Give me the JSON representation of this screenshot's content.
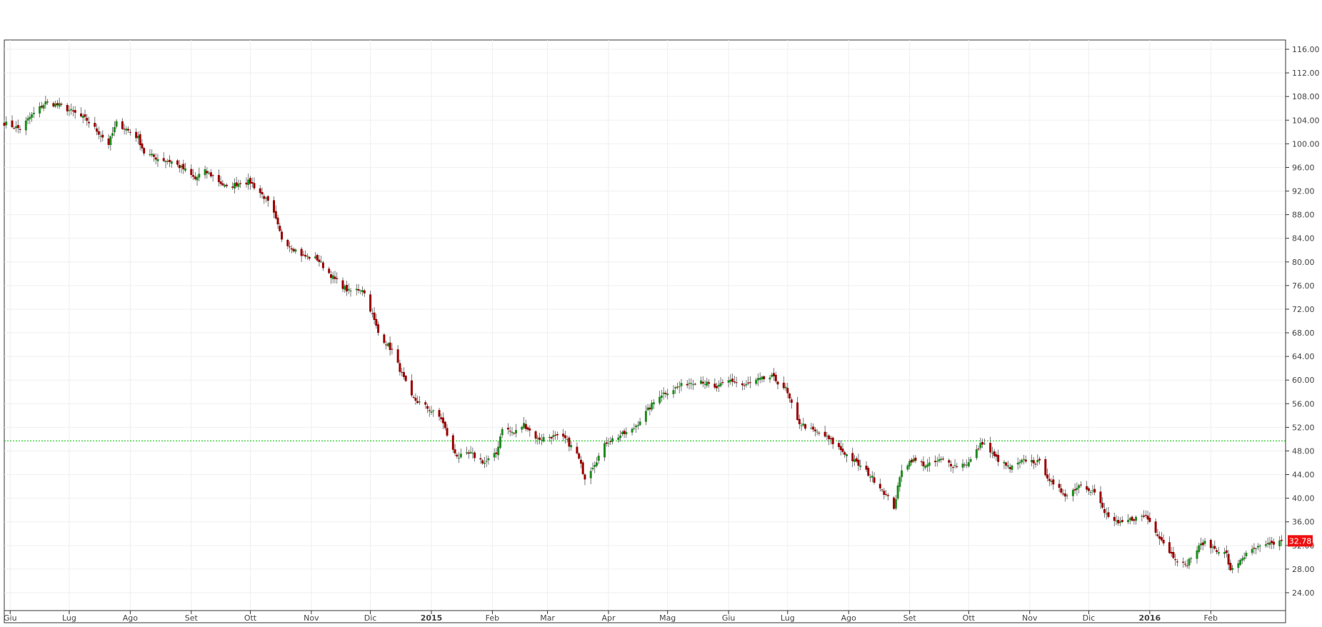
{
  "chart_data": {
    "type": "candlestick",
    "title": "",
    "xlabel": "",
    "ylabel": "",
    "ylim": [
      22,
      117
    ],
    "y_ticks": [
      "116.00",
      "112.00",
      "108.00",
      "104.00",
      "100.00",
      "96.00",
      "92.00",
      "88.00",
      "84.00",
      "80.00",
      "76.00",
      "72.00",
      "68.00",
      "64.00",
      "60.00",
      "56.00",
      "52.00",
      "48.00",
      "44.00",
      "40.00",
      "36.00",
      "32.00",
      "28.00",
      "24.00"
    ],
    "y_tick_values": [
      116,
      112,
      108,
      104,
      100,
      96,
      92,
      88,
      84,
      80,
      76,
      72,
      68,
      64,
      60,
      56,
      52,
      48,
      44,
      40,
      36,
      32,
      28,
      24
    ],
    "x_ticks": [
      {
        "label": "Giu",
        "date": "2014-06-01",
        "bold": false
      },
      {
        "label": "Lug",
        "date": "2014-07-01",
        "bold": false
      },
      {
        "label": "Ago",
        "date": "2014-08-01",
        "bold": false
      },
      {
        "label": "Set",
        "date": "2014-09-01",
        "bold": false
      },
      {
        "label": "Ott",
        "date": "2014-10-01",
        "bold": false
      },
      {
        "label": "Nov",
        "date": "2014-11-01",
        "bold": false
      },
      {
        "label": "Dic",
        "date": "2014-12-01",
        "bold": false
      },
      {
        "label": "2015",
        "date": "2015-01-01",
        "bold": true
      },
      {
        "label": "Feb",
        "date": "2015-02-01",
        "bold": false
      },
      {
        "label": "Mar",
        "date": "2015-03-01",
        "bold": false
      },
      {
        "label": "Apr",
        "date": "2015-04-01",
        "bold": false
      },
      {
        "label": "Mag",
        "date": "2015-05-01",
        "bold": false
      },
      {
        "label": "Giu",
        "date": "2015-06-01",
        "bold": false
      },
      {
        "label": "Lug",
        "date": "2015-07-01",
        "bold": false
      },
      {
        "label": "Ago",
        "date": "2015-08-01",
        "bold": false
      },
      {
        "label": "Set",
        "date": "2015-09-01",
        "bold": false
      },
      {
        "label": "Ott",
        "date": "2015-10-01",
        "bold": false
      },
      {
        "label": "Nov",
        "date": "2015-11-01",
        "bold": false
      },
      {
        "label": "Dic",
        "date": "2015-12-01",
        "bold": false
      },
      {
        "label": "2016",
        "date": "2016-01-01",
        "bold": true
      },
      {
        "label": "Feb",
        "date": "2016-02-01",
        "bold": false
      }
    ],
    "x_range": [
      "2014-05-29",
      "2016-03-10"
    ],
    "close_path": [
      [
        "2014-05-29",
        103.5
      ],
      [
        "2014-06-06",
        102.5
      ],
      [
        "2014-06-11",
        104.5
      ],
      [
        "2014-06-19",
        107.0
      ],
      [
        "2014-06-26",
        106.5
      ],
      [
        "2014-07-02",
        105.5
      ],
      [
        "2014-07-10",
        104.0
      ],
      [
        "2014-07-17",
        101.5
      ],
      [
        "2014-07-21",
        100.0
      ],
      [
        "2014-07-25",
        103.5
      ],
      [
        "2014-07-30",
        102.5
      ],
      [
        "2014-08-05",
        101.0
      ],
      [
        "2014-08-08",
        98.5
      ],
      [
        "2014-08-15",
        97.5
      ],
      [
        "2014-08-22",
        97.0
      ],
      [
        "2014-08-29",
        95.5
      ],
      [
        "2014-09-03",
        94.0
      ],
      [
        "2014-09-07",
        95.5
      ],
      [
        "2014-09-12",
        94.5
      ],
      [
        "2014-09-19",
        92.5
      ],
      [
        "2014-09-26",
        93.5
      ],
      [
        "2014-10-01",
        93.5
      ],
      [
        "2014-10-08",
        91.0
      ],
      [
        "2014-10-12",
        89.0
      ],
      [
        "2014-10-17",
        84.0
      ],
      [
        "2014-10-22",
        82.5
      ],
      [
        "2014-10-28",
        81.0
      ],
      [
        "2014-11-04",
        80.5
      ],
      [
        "2014-11-09",
        78.5
      ],
      [
        "2014-11-13",
        77.0
      ],
      [
        "2014-11-20",
        75.0
      ],
      [
        "2014-11-27",
        75.5
      ],
      [
        "2014-12-01",
        72.0
      ],
      [
        "2014-12-05",
        68.0
      ],
      [
        "2014-12-12",
        65.0
      ],
      [
        "2014-12-17",
        61.0
      ],
      [
        "2014-12-22",
        57.0
      ],
      [
        "2014-12-29",
        55.5
      ],
      [
        "2015-01-06",
        53.5
      ],
      [
        "2015-01-12",
        48.0
      ],
      [
        "2015-01-15",
        47.0
      ],
      [
        "2015-01-21",
        47.5
      ],
      [
        "2015-01-28",
        46.0
      ],
      [
        "2015-02-03",
        47.5
      ],
      [
        "2015-02-06",
        52.0
      ],
      [
        "2015-02-12",
        51.0
      ],
      [
        "2015-02-17",
        52.5
      ],
      [
        "2015-02-24",
        50.0
      ],
      [
        "2015-03-03",
        50.5
      ],
      [
        "2015-03-10",
        50.0
      ],
      [
        "2015-03-16",
        47.5
      ],
      [
        "2015-03-20",
        43.5
      ],
      [
        "2015-03-26",
        46.5
      ],
      [
        "2015-03-31",
        49.5
      ],
      [
        "2015-04-06",
        50.5
      ],
      [
        "2015-04-13",
        51.5
      ],
      [
        "2015-04-20",
        54.5
      ],
      [
        "2015-04-27",
        57.5
      ],
      [
        "2015-05-04",
        58.5
      ],
      [
        "2015-05-11",
        59.5
      ],
      [
        "2015-05-18",
        60.0
      ],
      [
        "2015-05-25",
        58.5
      ],
      [
        "2015-06-02",
        60.0
      ],
      [
        "2015-06-09",
        59.0
      ],
      [
        "2015-06-16",
        60.0
      ],
      [
        "2015-06-23",
        60.5
      ],
      [
        "2015-06-30",
        58.5
      ],
      [
        "2015-07-06",
        53.0
      ],
      [
        "2015-07-13",
        51.5
      ],
      [
        "2015-07-20",
        50.5
      ],
      [
        "2015-07-27",
        48.5
      ],
      [
        "2015-08-03",
        46.5
      ],
      [
        "2015-08-10",
        44.5
      ],
      [
        "2015-08-17",
        42.0
      ],
      [
        "2015-08-24",
        38.5
      ],
      [
        "2015-08-28",
        45.0
      ],
      [
        "2015-09-02",
        46.5
      ],
      [
        "2015-09-10",
        45.5
      ],
      [
        "2015-09-17",
        46.5
      ],
      [
        "2015-09-24",
        45.5
      ],
      [
        "2015-10-01",
        46.0
      ],
      [
        "2015-10-08",
        49.5
      ],
      [
        "2015-10-14",
        47.0
      ],
      [
        "2015-10-22",
        45.0
      ],
      [
        "2015-10-30",
        46.5
      ],
      [
        "2015-11-06",
        46.0
      ],
      [
        "2015-11-13",
        42.0
      ],
      [
        "2015-11-20",
        40.5
      ],
      [
        "2015-11-27",
        42.5
      ],
      [
        "2015-12-04",
        41.0
      ],
      [
        "2015-12-09",
        37.5
      ],
      [
        "2015-12-16",
        35.5
      ],
      [
        "2015-12-23",
        36.5
      ],
      [
        "2015-12-30",
        37.0
      ],
      [
        "2016-01-07",
        33.0
      ],
      [
        "2016-01-12",
        30.5
      ],
      [
        "2016-01-19",
        28.5
      ],
      [
        "2016-01-22",
        30.0
      ],
      [
        "2016-01-28",
        32.5
      ],
      [
        "2016-02-03",
        31.5
      ],
      [
        "2016-02-09",
        30.5
      ],
      [
        "2016-02-11",
        27.5
      ],
      [
        "2016-02-17",
        30.0
      ],
      [
        "2016-02-24",
        31.5
      ],
      [
        "2016-03-01",
        32.0
      ],
      [
        "2016-03-08",
        32.78
      ]
    ],
    "reference_line": {
      "value": 49.7,
      "color": "#00c000",
      "style": "dotted"
    },
    "last_price": {
      "label": "32.78",
      "value": 32.78,
      "color": "#ee1111"
    },
    "up_color": "#1e8c1e",
    "down_color": "#9b0000",
    "grid": true,
    "legend": "none"
  }
}
